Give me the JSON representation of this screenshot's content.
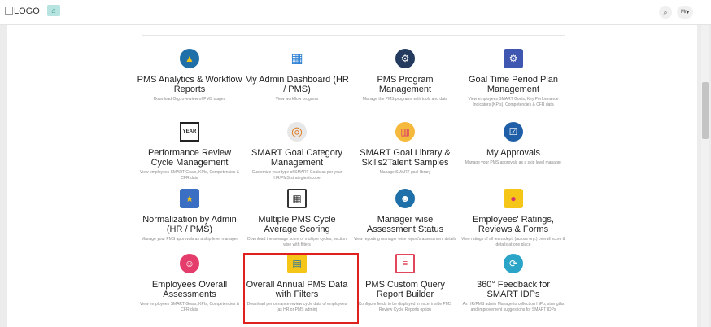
{
  "header": {
    "logo_alt": "LOGO",
    "user_initials": "Mr"
  },
  "tiles": [
    {
      "title": "PMS Analytics & Workflow Reports",
      "desc": "Download Org. overview of PMS stages",
      "icon": "analytics-icon"
    },
    {
      "title": "My Admin Dashboard (HR / PMS)",
      "desc": "View workflow progress",
      "icon": "dashboard-icon"
    },
    {
      "title": "PMS Program Management",
      "desc": "Manage the PMS programs with tools and data",
      "icon": "program-management-icon"
    },
    {
      "title": "Goal Time Period Plan Management",
      "desc": "View employees SMART Goals, Key Performance Indicators (KPIs), Competencies & CFR data",
      "icon": "calendar-settings-icon"
    },
    {
      "title": "Performance Review Cycle Management",
      "desc": "View employees SMART Goals, KPIs, Competencies & CFR data",
      "icon": "year-calendar-icon"
    },
    {
      "title": "SMART Goal Category Management",
      "desc": "Customize your type of SMART Goals as per your HR/PMS strategies/scope",
      "icon": "target-icon"
    },
    {
      "title": "SMART Goal Library & Skills2Talent Samples",
      "desc": "Manage SMART goal library",
      "icon": "library-icon"
    },
    {
      "title": "My Approvals",
      "desc": "Manage your PMS approvals as a skip level manager",
      "icon": "approval-check-icon"
    },
    {
      "title": "Normalization by Admin (HR / PMS)",
      "desc": "Manage your PMS approvals as a skip level manager",
      "icon": "normalization-icon"
    },
    {
      "title": "Multiple PMS Cycle Average Scoring",
      "desc": "Download the average score of multiple cycles, section wise with filters",
      "icon": "grid-calendar-icon"
    },
    {
      "title": "Manager wise Assessment Status",
      "desc": "View reporting manager wise report's assessment details",
      "icon": "manager-icon"
    },
    {
      "title": "Employees' Ratings, Reviews & Forms",
      "desc": "View ratings of all team/dept. (across org.) overall score & details at one place",
      "icon": "ratings-folder-icon"
    },
    {
      "title": "Employees Overall Assessments",
      "desc": "View employees SMART Goals, KPIs, Competencies & CFR data",
      "icon": "assessment-icon"
    },
    {
      "title": "Overall Annual PMS Data with Filters",
      "desc": "Download performance review cycle data of employees (as HR or PMS admin)",
      "icon": "annual-data-icon"
    },
    {
      "title": "PMS Custom Query Report Builder",
      "desc": "Configure fields to be displayed in excel inside PMS Review Cycle Reports option",
      "icon": "report-builder-icon"
    },
    {
      "title": "360° Feedback for SMART IDPs",
      "desc": "As HR/PMS admin Manage to collect on HiPo, strengths and improvement suggestions for SMART IDPs",
      "icon": "feedback-360-icon"
    }
  ],
  "colors": {
    "highlight": "#e0201f",
    "accent_blue": "#1f5fa8"
  }
}
